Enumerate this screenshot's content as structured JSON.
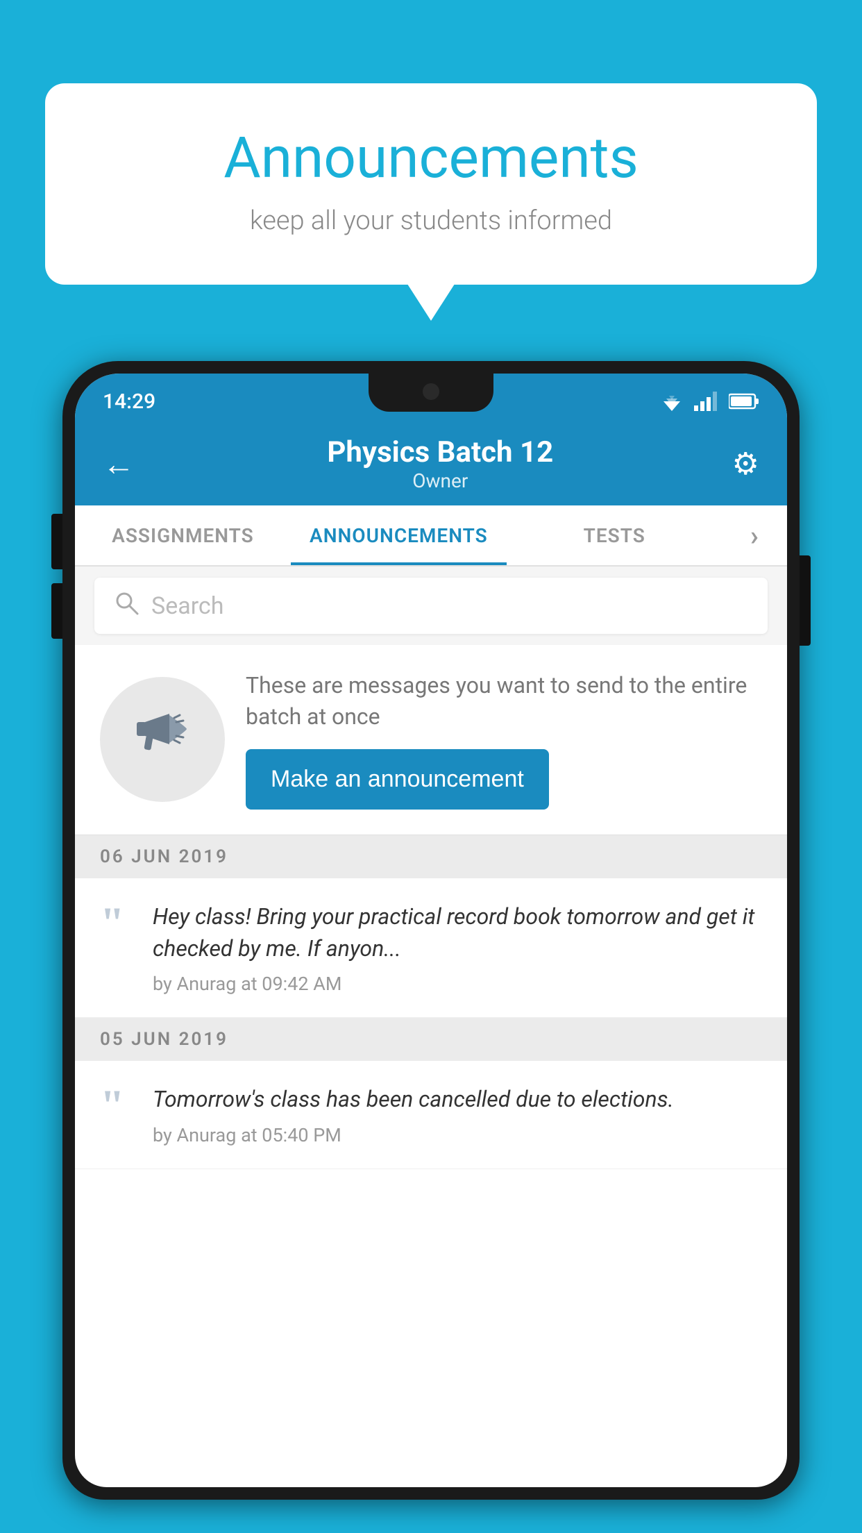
{
  "bubble": {
    "title": "Announcements",
    "subtitle": "keep all your students informed"
  },
  "status_bar": {
    "time": "14:29",
    "wifi": "▼",
    "signal": "▲",
    "battery": "▐"
  },
  "app_bar": {
    "title": "Physics Batch 12",
    "subtitle": "Owner",
    "back_label": "←",
    "gear_label": "⚙"
  },
  "tabs": [
    {
      "label": "ASSIGNMENTS",
      "active": false
    },
    {
      "label": "ANNOUNCEMENTS",
      "active": true
    },
    {
      "label": "TESTS",
      "active": false
    },
    {
      "label": "›",
      "active": false
    }
  ],
  "search": {
    "placeholder": "Search"
  },
  "promo": {
    "description": "These are messages you want to send to the entire batch at once",
    "button_label": "Make an announcement"
  },
  "announcements": [
    {
      "date": "06  JUN  2019",
      "text": "Hey class! Bring your practical record book tomorrow and get it checked by me. If anyon...",
      "meta": "by Anurag at 09:42 AM"
    },
    {
      "date": "05  JUN  2019",
      "text": "Tomorrow's class has been cancelled due to elections.",
      "meta": "by Anurag at 05:40 PM"
    }
  ]
}
